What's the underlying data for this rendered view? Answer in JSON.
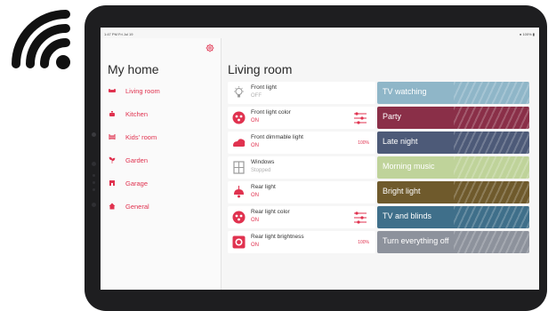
{
  "status_bar": {
    "time": "1:47 PM  Fri Jul 19",
    "battery": "100%"
  },
  "sidebar": {
    "title": "My home",
    "settings_icon": "gear-icon",
    "rooms": [
      {
        "label": "Living room",
        "icon": "sofa-icon"
      },
      {
        "label": "Kitchen",
        "icon": "pot-icon"
      },
      {
        "label": "Kids' room",
        "icon": "crib-icon"
      },
      {
        "label": "Garden",
        "icon": "plant-icon"
      },
      {
        "label": "Garage",
        "icon": "car-icon"
      },
      {
        "label": "General",
        "icon": "house-icon"
      }
    ]
  },
  "main": {
    "title": "Living room",
    "devices": [
      {
        "name": "Front light",
        "state": "OFF",
        "icon": "bulb-icon"
      },
      {
        "name": "Front light color",
        "state": "ON",
        "icon": "color-bulb-icon",
        "control": "color-sliders-icon"
      },
      {
        "name": "Front dimmable light",
        "state": "ON",
        "icon": "dimmer-icon",
        "level": "100%"
      },
      {
        "name": "Windows",
        "state": "Stopped",
        "icon": "window-icon"
      },
      {
        "name": "Rear light",
        "state": "ON",
        "icon": "pendant-lamp-icon"
      },
      {
        "name": "Rear light color",
        "state": "ON",
        "icon": "color-bulb-icon",
        "control": "color-sliders-icon"
      },
      {
        "name": "Rear light brightness",
        "state": "ON",
        "icon": "brightness-icon",
        "level": "100%"
      }
    ],
    "scenes": [
      {
        "label": "TV watching",
        "color": "#8fb6c8"
      },
      {
        "label": "Party",
        "color": "#8a2f48"
      },
      {
        "label": "Late night",
        "color": "#4d5a78"
      },
      {
        "label": "Morning music",
        "color": "#bfd39a"
      },
      {
        "label": "Bright light",
        "color": "#6f5a2c"
      },
      {
        "label": "TV and blinds",
        "color": "#3f6f8a"
      },
      {
        "label": "Turn everything off",
        "color": "#8d929c"
      }
    ]
  },
  "colors": {
    "accent": "#e0324f",
    "device_bg": "#ffffff",
    "screen_bg": "#f6f6f6"
  }
}
